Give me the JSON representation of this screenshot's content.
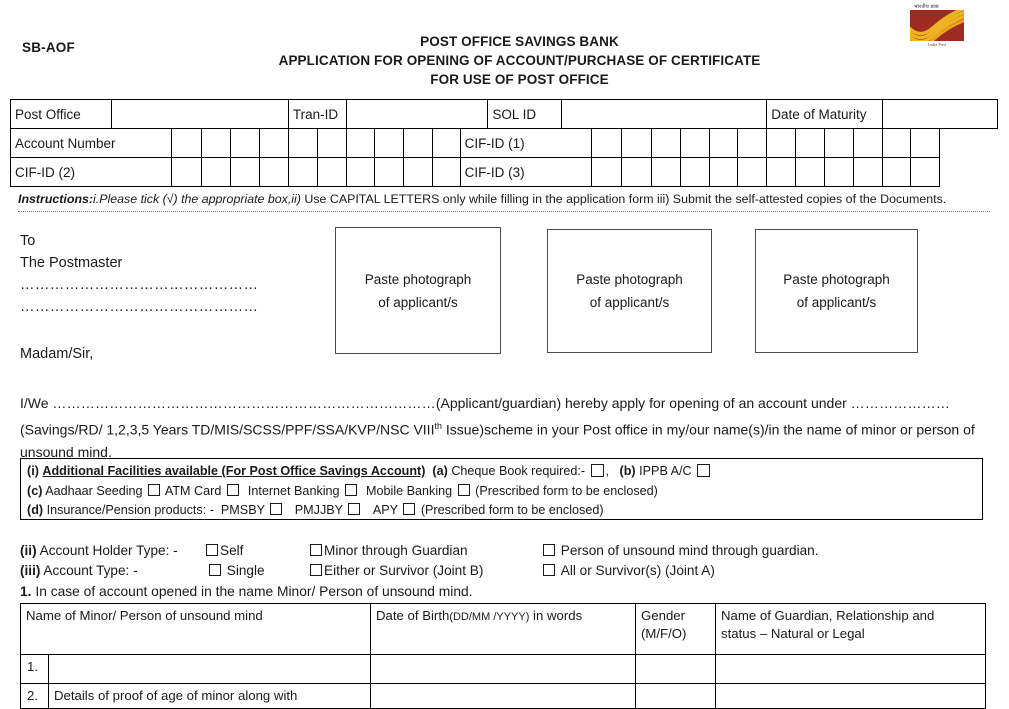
{
  "logo": {
    "name": "india-post-logo",
    "hindi_text": "भारतीय डाक",
    "english_text": "India Post",
    "plate_color": "#9e2a22",
    "swoosh_color": "#f0b323"
  },
  "header": {
    "form_code": "SB-AOF",
    "title_line_1": "POST OFFICE SAVINGS BANK",
    "title_line_2": "APPLICATION FOR OPENING OF ACCOUNT/PURCHASE OF CERTIFICATE",
    "title_line_3": "FOR USE OF POST OFFICE"
  },
  "grid_table": {
    "row1": {
      "post_office_label": "Post Office",
      "tran_id_label": "Tran-ID",
      "sol_id_label": "SOL ID",
      "date_of_maturity_label": "Date of Maturity"
    },
    "row2": {
      "account_number_label": "Account Number",
      "cif_id_1_label": "CIF-ID (1)"
    },
    "row3": {
      "cif_id_2_label": "CIF-ID (2)",
      "cif_id_3_label": "CIF-ID (3)"
    }
  },
  "instructions": {
    "bold_label": "Instructions:",
    "italic_part": "i.Please tick (√) the appropriate box,ii)",
    "rest": " Use CAPITAL LETTERS only while filling in the application form iii) Submit the self-attested copies of the Documents."
  },
  "to_block": {
    "to": "To",
    "postmaster": "The Postmaster",
    "dotted_line_1": "…………………………………………",
    "dotted_line_2": "…………………………………………",
    "salutation": "Madam/Sir,"
  },
  "photo_boxes": [
    {
      "line1": "Paste photograph",
      "line2": "of applicant/s"
    },
    {
      "line1": "Paste photograph",
      "line2": "of applicant/s"
    },
    {
      "line1": "Paste photograph",
      "line2": "of applicant/s"
    }
  ],
  "body_paragraph": {
    "lead": "I/We",
    "blank_1": "………………………………………………………………………",
    "after_blank_1": "(Applicant/guardian) hereby apply for opening of an account under",
    "blank_2": "…………………",
    "scheme_text_before_sup": "(Savings/RD/ 1,2,3,5 Years TD/MIS/SCSS/PPF/SSA/KVP/NSC VIII",
    "superscript": "th",
    "scheme_text_after_sup": " Issue)scheme in your Post office in my/our name(s)/in",
    "line_3": "the name of minor or person of unsound mind."
  },
  "facilities": {
    "roman": "(i)",
    "heading": "Additional Facilities available (For Post Office Savings Account)",
    "a_label": "(a)",
    "a_text": "Cheque Book required:-",
    "comma": ",",
    "b_label": "(b)",
    "b_text": "IPPB A/C",
    "c_label": "(c)",
    "c_item_1": "Aadhaar Seeding",
    "c_item_2": "ATM Card",
    "c_item_3": "Internet Banking",
    "c_item_4": "Mobile Banking",
    "c_note": "(Prescribed form to be enclosed)",
    "d_label": "(d)",
    "d_text": "Insurance/Pension products: -",
    "d_item_1": "PMSBY",
    "d_item_2": "PMJJBY",
    "d_item_3": "APY",
    "d_note": "(Prescribed form to be enclosed)"
  },
  "holder_type": {
    "roman": "(ii)",
    "label": "Account Holder Type: -",
    "option_1": "Self",
    "option_2": "Minor through Guardian",
    "option_3": "Person of unsound mind through guardian."
  },
  "account_type": {
    "roman": "(iii)",
    "label": "Account Type: -",
    "option_1": "Single",
    "option_2": "Either or Survivor (Joint B)",
    "option_3": "All or Survivor(s) (Joint A)"
  },
  "minor_section": {
    "number": "1.",
    "text": "In case of account opened in the name Minor/ Person of unsound mind.",
    "columns": [
      "Name of Minor/ Person of unsound mind",
      "Date of Birth(DD/MM /YYYY)  in words",
      "Gender (M/F/O)",
      "Name of Guardian, Relationship and status – Natural or Legal"
    ],
    "col_2_main": "Date of Birth",
    "col_2_small": "(DD/MM /YYYY)",
    "col_2_tail": " in words",
    "col_3_line1": "Gender",
    "col_3_line2": "(M/F/O)",
    "col_4_line1": "Name of Guardian, Relationship and",
    "col_4_line2": "status – Natural or Legal",
    "rows": [
      {
        "num": "1.",
        "name": "",
        "dob": "",
        "gender": "",
        "guardian": ""
      },
      {
        "num": "2.",
        "name": "Details of proof of age of minor along with",
        "dob": "",
        "gender": "",
        "guardian": ""
      }
    ]
  }
}
